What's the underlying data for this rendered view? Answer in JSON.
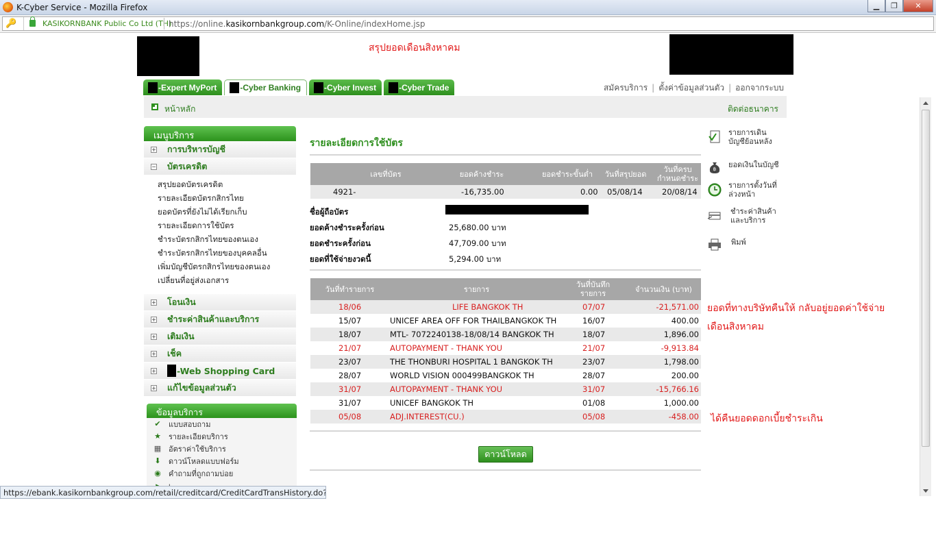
{
  "window": {
    "title": "K-Cyber Service - Mozilla Firefox",
    "min": "▁",
    "max": "❐",
    "close": "✕"
  },
  "browser": {
    "org": "KASIKORNBANK Public Co Ltd (TH)",
    "url_prefix": "https://online.",
    "url_domain": "kasikornbankgroup.com",
    "url_path": "/K-Online/indexHome.jsp",
    "status_url": "https://ebank.kasikornbankgroup.com/retail/creditcard/CreditCardTransHistory.do?#faq"
  },
  "annotations": {
    "top": "สรุปยอดเดือนสิงหาคม",
    "refund": "ยอดที่ทางบริษัทคืนให้ กลับอยู่ยอดค่าใช้จ่าย",
    "refund2": "เดือนสิงหาคม",
    "interest": "ได้คืนยอดดอกเบี้ยชำระเกิน"
  },
  "tabs": [
    {
      "label": "-Expert MyPort"
    },
    {
      "label": "-Cyber Banking"
    },
    {
      "label": "-Cyber Invest"
    },
    {
      "label": "-Cyber Trade"
    }
  ],
  "toplinks": {
    "register": "สมัครบริการ",
    "settings": "ตั้งค่าข้อมูลส่วนตัว",
    "logout": "ออกจากระบบ",
    "sep": "|"
  },
  "homebar": {
    "home": "หน้าหลัก",
    "contact": "ติดต่อธนาคาร"
  },
  "sidebar": {
    "header": "เมนูบริการ",
    "account_mgmt": "การบริหารบัญชี",
    "credit_card": "บัตรเครดิต",
    "sub": [
      "สรุปยอดบัตรเครดิต",
      "รายละเอียดบัตรกสิกรไทย",
      "ยอดบัตรที่ยังไม่ได้เรียกเก็บ",
      "รายละเอียดการใช้บัตร",
      "ชำระบัตรกสิกรไทยของตนเอง",
      "ชำระบัตรกสิกรไทยของบุคคลอื่น",
      "เพิ่มบัญชีบัตรกสิกรไทยของตนเอง",
      "เปลี่ยนที่อยู่ส่งเอกสาร"
    ],
    "items": [
      "โอนเงิน",
      "ชำระค่าสินค้าและบริการ",
      "เติมเงิน",
      "เช็ค",
      "-Web Shopping Card",
      "แก้ไขข้อมูลส่วนตัว"
    ],
    "plus": "+",
    "minus": "−"
  },
  "service_info": {
    "header": "ข้อมูลบริการ",
    "items": [
      "แบบสอบถาม",
      "รายละเอียดบริการ",
      "อัตราค่าใช้บริการ",
      "ดาวน์โหลดแบบฟอร์ม",
      "คำถามที่ถูกถามบ่อย",
      "เ..."
    ]
  },
  "main": {
    "title": "รายละเอียดการใช้บัตร",
    "card_headers": {
      "card_no": "เลขที่บัตร",
      "balance": "ยอดค้างชำระ",
      "min_pay": "ยอดชำระขั้นต่ำ",
      "stmt_date": "วันที่สรุปยอด",
      "due1": "วันที่ครบ",
      "due2": "กำหนดชำระ"
    },
    "card": {
      "card_no": "4921-",
      "balance": "-16,735.00",
      "min_pay": "0.00",
      "stmt_date": "05/08/14",
      "due": "20/08/14"
    },
    "holder_label": "ชื่อผู้ถือบัตร",
    "info": [
      {
        "label": "ยอดค้างชำระครั้งก่อน",
        "value": "25,680.00 บาท"
      },
      {
        "label": "ยอดชำระครั้งก่อน",
        "value": "47,709.00 บาท"
      },
      {
        "label": "ยอดที่ใช้จ่ายงวดนี้",
        "value": "5,294.00 บาท"
      }
    ],
    "tx_headers": {
      "date": "วันที่ทำรายการ",
      "desc": "รายการ",
      "post1": "วันที่บันทึก",
      "post2": "รายการ",
      "amount": "จำนวนเงิน (บาท)"
    },
    "transactions": [
      {
        "date": "18/06",
        "desc": "LIFE BANGKOK TH",
        "post": "07/07",
        "amount": "-21,571.00",
        "red": true
      },
      {
        "date": "15/07",
        "desc": "UNICEF AREA OFF FOR THAILBANGKOK TH",
        "post": "16/07",
        "amount": "400.00",
        "red": false
      },
      {
        "date": "18/07",
        "desc": "MTL- 7072240138-18/08/14 BANGKOK TH",
        "post": "18/07",
        "amount": "1,896.00",
        "red": false
      },
      {
        "date": "21/07",
        "desc": "AUTOPAYMENT - THANK YOU",
        "post": "21/07",
        "amount": "-9,913.84",
        "red": true
      },
      {
        "date": "23/07",
        "desc": "THE THONBURI HOSPITAL 1 BANGKOK TH",
        "post": "23/07",
        "amount": "1,798.00",
        "red": false
      },
      {
        "date": "28/07",
        "desc": "WORLD VISION 000499BANGKOK TH",
        "post": "28/07",
        "amount": "200.00",
        "red": false
      },
      {
        "date": "31/07",
        "desc": "AUTOPAYMENT - THANK YOU",
        "post": "31/07",
        "amount": "-15,766.16",
        "red": true
      },
      {
        "date": "31/07",
        "desc": "UNICEF BANGKOK TH",
        "post": "01/08",
        "amount": "1,000.00",
        "red": false
      },
      {
        "date": "05/08",
        "desc": "ADJ.INTEREST(CU.)",
        "post": "05/08",
        "amount": "-458.00",
        "red": true
      }
    ],
    "download": "ดาวน์โหลด"
  },
  "right_links": [
    {
      "label": "รายการเดินบัญชีย้อนหลัง",
      "icon": "statement-icon"
    },
    {
      "label": "ยอดเงินในบัญชี",
      "icon": "money-bag-icon"
    },
    {
      "label": "รายการตั้งวันที่ล่วงหน้า",
      "icon": "clock-icon"
    },
    {
      "label": "ชำระค่าสินค้าและบริการ",
      "icon": "payment-icon"
    },
    {
      "label": "พิมพ์",
      "icon": "printer-icon"
    }
  ]
}
